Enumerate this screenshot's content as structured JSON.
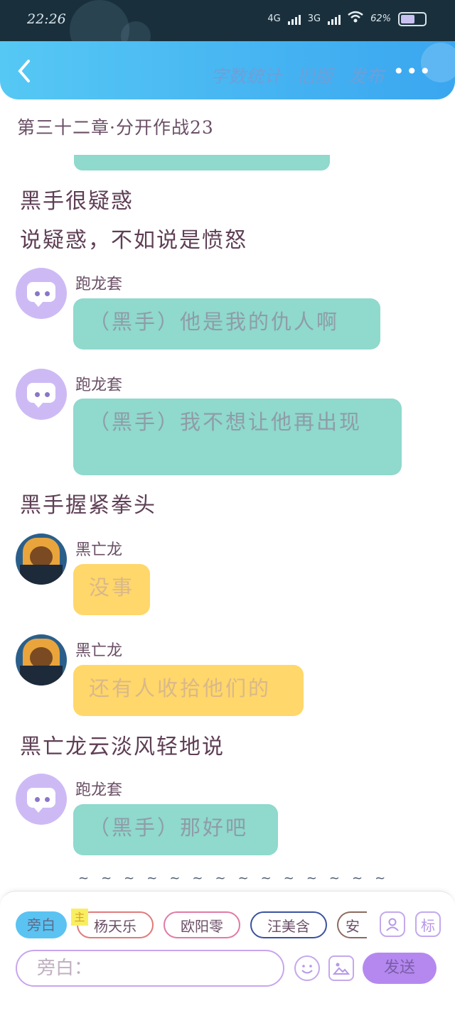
{
  "status_bar": {
    "time": "22:26",
    "network1": "4G",
    "network2": "3G",
    "battery": "62%",
    "battery_level": 0.62
  },
  "nav": {
    "actions": [
      "字数统计",
      "旧版",
      "发布"
    ],
    "more": "•••"
  },
  "chapter_title": "第三十二章·分开作战23",
  "messages": [
    {
      "type": "narration",
      "text": "黑手很疑惑"
    },
    {
      "type": "narration",
      "text": "说疑惑，不如说是愤怒"
    },
    {
      "type": "chat",
      "name": "跑龙套",
      "text": "（黑手）他是我的仇人啊",
      "color": "#8fd9cd"
    },
    {
      "type": "chat",
      "name": "跑龙套",
      "text": "（黑手）我不想让他再出现",
      "color": "#8fd9cd"
    },
    {
      "type": "narration",
      "text": "黑手握紧拳头"
    },
    {
      "type": "chat",
      "name": "黑亡龙",
      "text": "没事",
      "color": "#ffd76a"
    },
    {
      "type": "chat",
      "name": "黑亡龙",
      "text": "还有人收拾他们的",
      "color": "#ffd76a"
    },
    {
      "type": "narration",
      "text": "黑亡龙云淡风轻地说"
    },
    {
      "type": "chat",
      "name": "跑龙套",
      "text": "（黑手）那好吧",
      "color": "#8fd9cd"
    }
  ],
  "end_marker": "~~~~~~~~~~~~~~",
  "composer": {
    "roles": [
      "旁白",
      "杨天乐",
      "欧阳零",
      "汪美含",
      "安"
    ],
    "main_badge": "主",
    "tag_button": "标",
    "input_placeholder": "旁白：",
    "send_label": "发送"
  }
}
